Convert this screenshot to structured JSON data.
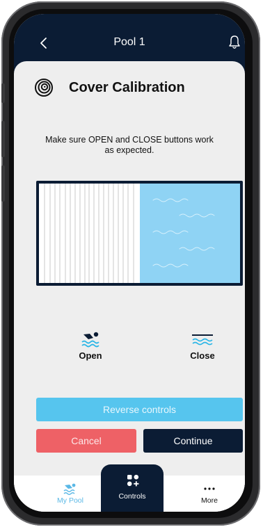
{
  "header": {
    "title": "Pool 1",
    "back_icon": "chevron-left-icon",
    "bell_icon": "bell-icon"
  },
  "page": {
    "title": "Cover Calibration",
    "icon": "spiral-icon",
    "instruction": "Make sure OPEN and CLOSE buttons work as expected."
  },
  "controls": {
    "open_label": "Open",
    "close_label": "Close"
  },
  "buttons": {
    "reverse": "Reverse controls",
    "cancel": "Cancel",
    "continue": "Continue"
  },
  "tabbar": {
    "my_pool": "My Pool",
    "controls": "Controls",
    "more": "More"
  },
  "colors": {
    "navy": "#0b1c34",
    "accent_blue": "#56c5ee",
    "water": "#8fd3f4",
    "cancel_red": "#ee6166"
  }
}
